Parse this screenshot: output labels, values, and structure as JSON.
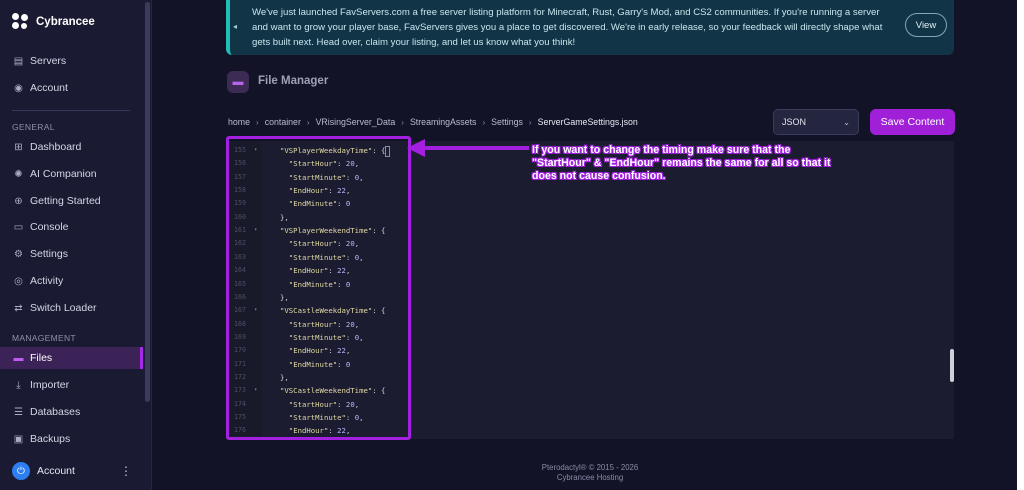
{
  "brand": {
    "name": "Cybrancee"
  },
  "sidebar": {
    "top_items": [
      {
        "label": "Servers",
        "icon": "server-icon"
      },
      {
        "label": "Account",
        "icon": "account-icon"
      }
    ],
    "general_title": "GENERAL",
    "general_items": [
      {
        "label": "Dashboard",
        "icon": "grid-icon"
      },
      {
        "label": "AI Companion",
        "icon": "bot-icon"
      },
      {
        "label": "Getting Started",
        "icon": "compass-icon"
      },
      {
        "label": "Console",
        "icon": "terminal-icon"
      },
      {
        "label": "Settings",
        "icon": "gear-icon"
      },
      {
        "label": "Activity",
        "icon": "eye-icon"
      },
      {
        "label": "Switch Loader",
        "icon": "switch-icon"
      }
    ],
    "management_title": "MANAGEMENT",
    "management_items": [
      {
        "label": "Files",
        "icon": "folder-icon",
        "active": true
      },
      {
        "label": "Importer",
        "icon": "download-icon"
      },
      {
        "label": "Databases",
        "icon": "database-icon"
      },
      {
        "label": "Backups",
        "icon": "archive-icon"
      }
    ],
    "account": {
      "label": "Account",
      "menu_glyph": "⋮"
    }
  },
  "banner": {
    "text": "We've just launched FavServers.com a free server listing platform for Minecraft, Rust, Garry's Mod, and CS2 communities. If you're running a server and want to grow your player base, FavServers gives you a place to get discovered. We're in early release, so your feedback will directly shape what gets built next. Head over, claim your listing, and let us know what you think!",
    "button": "View"
  },
  "page": {
    "title": "File Manager"
  },
  "breadcrumb": [
    "home",
    "container",
    "VRisingServer_Data",
    "StreamingAssets",
    "Settings"
  ],
  "breadcrumb_current": "ServerGameSettings.json",
  "language_select": {
    "value": "JSON"
  },
  "save_button": "Save Content",
  "editor": {
    "lines": [
      {
        "n": "155",
        "fold": true,
        "indent": 2,
        "key": "\"VSPlayerWeekdayTime\"",
        "rest": ": {"
      },
      {
        "n": "156",
        "indent": 3,
        "key": "\"StartHour\"",
        "rest": ": ",
        "num": "20",
        "tail": ","
      },
      {
        "n": "157",
        "indent": 3,
        "key": "\"StartMinute\"",
        "rest": ": ",
        "num": "0",
        "tail": ","
      },
      {
        "n": "158",
        "indent": 3,
        "key": "\"EndHour\"",
        "rest": ": ",
        "num": "22",
        "tail": ","
      },
      {
        "n": "159",
        "indent": 3,
        "key": "\"EndMinute\"",
        "rest": ": ",
        "num": "0",
        "tail": ""
      },
      {
        "n": "160",
        "indent": 2,
        "key": "",
        "rest": "},",
        "num": "",
        "tail": ""
      },
      {
        "n": "161",
        "fold": true,
        "indent": 2,
        "key": "\"VSPlayerWeekendTime\"",
        "rest": ": {"
      },
      {
        "n": "162",
        "indent": 3,
        "key": "\"StartHour\"",
        "rest": ": ",
        "num": "20",
        "tail": ","
      },
      {
        "n": "163",
        "indent": 3,
        "key": "\"StartMinute\"",
        "rest": ": ",
        "num": "0",
        "tail": ","
      },
      {
        "n": "164",
        "indent": 3,
        "key": "\"EndHour\"",
        "rest": ": ",
        "num": "22",
        "tail": ","
      },
      {
        "n": "165",
        "indent": 3,
        "key": "\"EndMinute\"",
        "rest": ": ",
        "num": "0",
        "tail": ""
      },
      {
        "n": "166",
        "indent": 2,
        "key": "",
        "rest": "},",
        "num": "",
        "tail": ""
      },
      {
        "n": "167",
        "fold": true,
        "indent": 2,
        "key": "\"VSCastleWeekdayTime\"",
        "rest": ": {"
      },
      {
        "n": "168",
        "indent": 3,
        "key": "\"StartHour\"",
        "rest": ": ",
        "num": "20",
        "tail": ","
      },
      {
        "n": "169",
        "indent": 3,
        "key": "\"StartMinute\"",
        "rest": ": ",
        "num": "0",
        "tail": ","
      },
      {
        "n": "170",
        "indent": 3,
        "key": "\"EndHour\"",
        "rest": ": ",
        "num": "22",
        "tail": ","
      },
      {
        "n": "171",
        "indent": 3,
        "key": "\"EndMinute\"",
        "rest": ": ",
        "num": "0",
        "tail": ""
      },
      {
        "n": "172",
        "indent": 2,
        "key": "",
        "rest": "},",
        "num": "",
        "tail": ""
      },
      {
        "n": "173",
        "fold": true,
        "indent": 2,
        "key": "\"VSCastleWeekendTime\"",
        "rest": ": {"
      },
      {
        "n": "174",
        "indent": 3,
        "key": "\"StartHour\"",
        "rest": ": ",
        "num": "20",
        "tail": ","
      },
      {
        "n": "175",
        "indent": 3,
        "key": "\"StartMinute\"",
        "rest": ": ",
        "num": "0",
        "tail": ","
      },
      {
        "n": "176",
        "indent": 3,
        "key": "\"EndHour\"",
        "rest": ": ",
        "num": "22",
        "tail": ","
      }
    ]
  },
  "annotation": "If you want to change the timing make sure that the \"StartHour\" & \"EndHour\" remains the same for all so that it does not cause confusion.",
  "footer": {
    "line1": "Pterodactyl® © 2015 - 2026",
    "line2": "Cybrancee Hosting"
  },
  "colors": {
    "accent": "#a320e0",
    "banner_accent": "#1fbfb5",
    "background": "#121327"
  }
}
